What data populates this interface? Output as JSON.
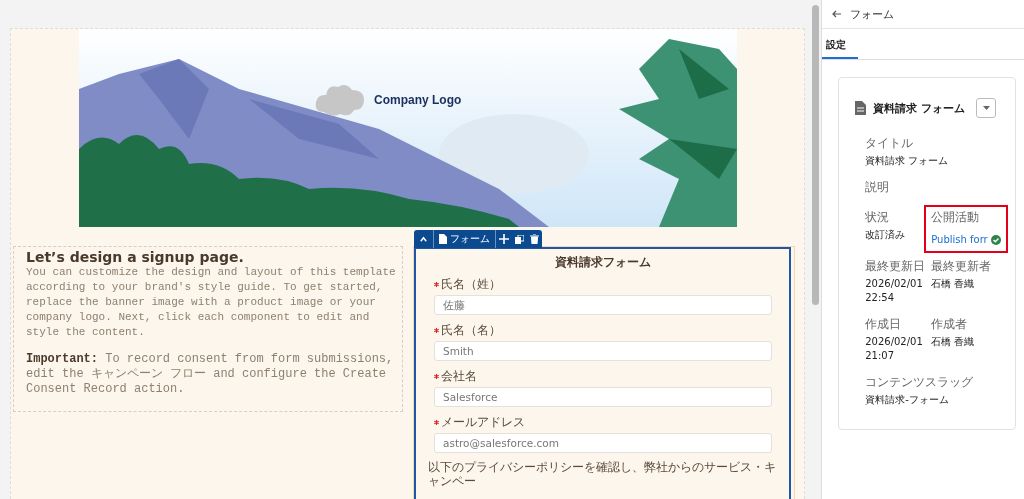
{
  "banner": {
    "logo_text": "Company Logo"
  },
  "intro": {
    "heading": "Let’s design a signup page.",
    "body": "You can customize the design and layout of this template according to your brand's style guide. To get started, replace the banner image with a product image or your company logo. Next, click each component to edit and style the content.",
    "note": "**Important:** To record consent from form submissions, edit the キャンペーン フロー and configure the Create Consent Record action."
  },
  "form_toolbar": {
    "label": "フォーム"
  },
  "form": {
    "title": "資料請求フォーム",
    "fields": [
      {
        "label": "氏名（姓）",
        "required": true,
        "placeholder": "佐藤"
      },
      {
        "label": "氏名（名）",
        "required": true,
        "placeholder": "Smith"
      },
      {
        "label": "会社名",
        "required": true,
        "placeholder": "Salesforce"
      },
      {
        "label": "メールアドレス",
        "required": true,
        "placeholder": "astro@salesforce.com"
      }
    ],
    "consent_text": "以下のプライバシーポリシーを確認し、弊社からのサービス・キャンペー"
  },
  "panel": {
    "back_title": "フォーム",
    "tabs": [
      {
        "label": "設定",
        "selected": true
      }
    ],
    "card": {
      "title": "資料請求 フォーム",
      "rows": [
        [
          {
            "label": "タイトル",
            "value": "資料請求 フォーム",
            "kind": "text",
            "highlighted": false
          }
        ],
        [
          {
            "label": "説明",
            "kind": "text",
            "highlighted": false
          }
        ],
        [
          {
            "label": "状況",
            "value": "改訂済み",
            "kind": "text",
            "highlighted": false
          },
          {
            "label": "公開活動",
            "value": "Publish forr",
            "kind": "link",
            "highlighted": true
          }
        ],
        [
          {
            "label": "最終更新日",
            "value": "2026/02/01 22:54",
            "kind": "text",
            "highlighted": false
          },
          {
            "label": "最終更新者",
            "value": "石橋 香織",
            "kind": "text",
            "highlighted": false
          }
        ],
        [
          {
            "label": "作成日",
            "value": "2026/02/01 21:07",
            "kind": "text",
            "highlighted": false
          },
          {
            "label": "作成者",
            "value": "石橋 香織",
            "kind": "text",
            "highlighted": false
          }
        ],
        [
          {
            "label": "コンテンツスラッグ",
            "value": "資料請求-フォーム",
            "kind": "text",
            "highlighted": false
          }
        ]
      ]
    }
  }
}
